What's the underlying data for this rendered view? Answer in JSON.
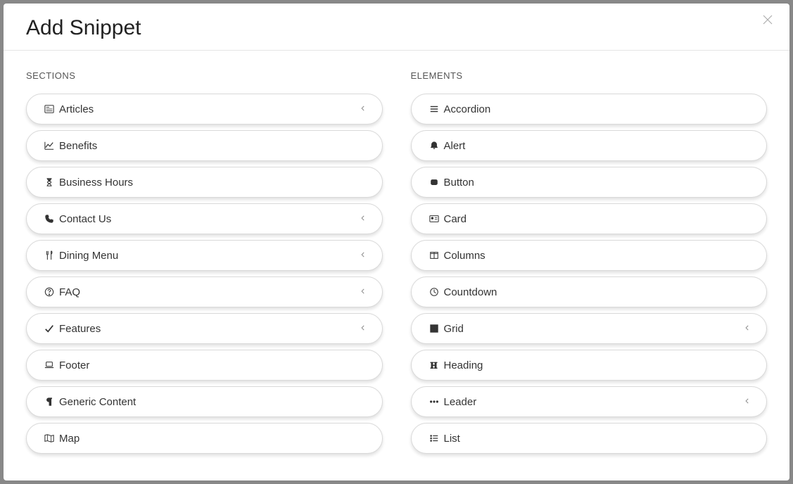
{
  "modal": {
    "title": "Add Snippet"
  },
  "sections": {
    "heading": "SECTIONS",
    "items": [
      {
        "icon": "newspaper",
        "label": "Articles",
        "chevron": true
      },
      {
        "icon": "chart-line",
        "label": "Benefits",
        "chevron": false
      },
      {
        "icon": "hourglass",
        "label": "Business Hours",
        "chevron": false
      },
      {
        "icon": "phone",
        "label": "Contact Us",
        "chevron": true
      },
      {
        "icon": "utensils",
        "label": "Dining Menu",
        "chevron": true
      },
      {
        "icon": "question-circle",
        "label": "FAQ",
        "chevron": true
      },
      {
        "icon": "check",
        "label": "Features",
        "chevron": true
      },
      {
        "icon": "laptop",
        "label": "Footer",
        "chevron": false
      },
      {
        "icon": "paragraph",
        "label": "Generic Content",
        "chevron": false
      },
      {
        "icon": "map",
        "label": "Map",
        "chevron": false
      }
    ]
  },
  "elements": {
    "heading": "ELEMENTS",
    "items": [
      {
        "icon": "bars",
        "label": "Accordion",
        "chevron": false
      },
      {
        "icon": "bell",
        "label": "Alert",
        "chevron": false
      },
      {
        "icon": "square-solid",
        "label": "Button",
        "chevron": false
      },
      {
        "icon": "id-card",
        "label": "Card",
        "chevron": false
      },
      {
        "icon": "columns",
        "label": "Columns",
        "chevron": false
      },
      {
        "icon": "clock",
        "label": "Countdown",
        "chevron": false
      },
      {
        "icon": "th",
        "label": "Grid",
        "chevron": true
      },
      {
        "icon": "heading",
        "label": "Heading",
        "chevron": false
      },
      {
        "icon": "ellipsis",
        "label": "Leader",
        "chevron": true
      },
      {
        "icon": "list",
        "label": "List",
        "chevron": false
      }
    ]
  }
}
